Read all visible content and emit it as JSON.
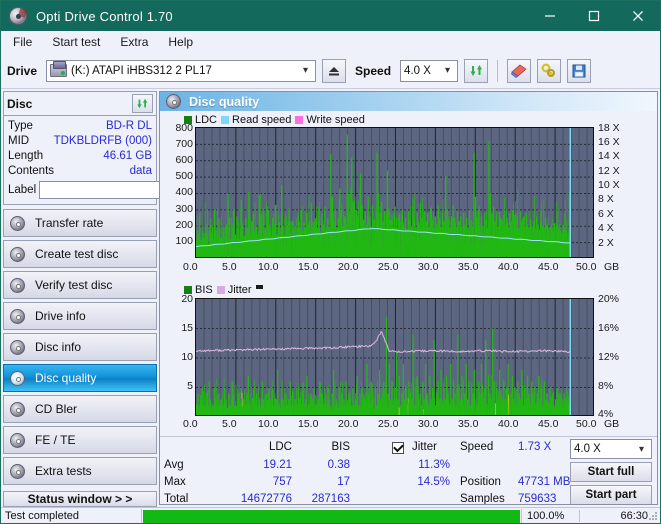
{
  "window": {
    "title": "Opti Drive Control 1.70",
    "icon": "disc-icon",
    "minimize": "minimize",
    "maximize": "maximize",
    "close": "close"
  },
  "menubar": {
    "items": [
      "File",
      "Start test",
      "Extra",
      "Help"
    ]
  },
  "toolbar": {
    "drive_label": "Drive",
    "drive_value": "(K:)  ATAPI iHBS312  2 PL17",
    "eject_title": "eject",
    "speed_label": "Speed",
    "speed_value": "4.0 X",
    "refresh_title": "refresh",
    "erase_title": "erase",
    "tools_title": "tools",
    "save_title": "save"
  },
  "disc": {
    "header": "Disc",
    "refresh_icon": "refresh-icon",
    "rows": [
      {
        "key": "Type",
        "value": "BD-R DL"
      },
      {
        "key": "MID",
        "value": "TDKBLDRFB (000)"
      },
      {
        "key": "Length",
        "value": "46.61 GB"
      },
      {
        "key": "Contents",
        "value": "data"
      }
    ],
    "label_key": "Label",
    "label_value": "",
    "label_placeholder": ""
  },
  "nav": {
    "items": [
      {
        "label": "Transfer rate",
        "active": false
      },
      {
        "label": "Create test disc",
        "active": false
      },
      {
        "label": "Verify test disc",
        "active": false
      },
      {
        "label": "Drive info",
        "active": false
      },
      {
        "label": "Disc info",
        "active": false
      },
      {
        "label": "Disc quality",
        "active": true
      },
      {
        "label": "CD Bler",
        "active": false
      },
      {
        "label": "FE / TE",
        "active": false
      },
      {
        "label": "Extra tests",
        "active": false
      }
    ],
    "status_window": "Status window > >"
  },
  "panel": {
    "title": "Disc quality",
    "icon": "disc-quality-icon"
  },
  "stats": {
    "col_ldc": "LDC",
    "col_bis": "BIS",
    "jitter_label": "Jitter",
    "jitter_checked": true,
    "rows": [
      {
        "key": "Avg",
        "ldc": "19.21",
        "bis": "0.38",
        "jitter": "11.3%"
      },
      {
        "key": "Max",
        "ldc": "757",
        "bis": "17",
        "jitter": "14.5%"
      },
      {
        "key": "Total",
        "ldc": "14672776",
        "bis": "287163",
        "jitter": ""
      }
    ],
    "speed_key": "Speed",
    "speed_value": "1.73 X",
    "position_key": "Position",
    "position_value": "47731 MB",
    "samples_key": "Samples",
    "samples_value": "759633",
    "speed_select": "4.0 X",
    "start_full": "Start full",
    "start_part": "Start part"
  },
  "statusbar": {
    "text": "Test completed",
    "percent": "100.0%",
    "progress": 100,
    "time": "66:30"
  },
  "colors": {
    "titlebar": "#12695c",
    "accent": "#2a2ad0",
    "plot_bg": "#5c6680",
    "ldc_green": "#22b814",
    "read_speed": "#7fd8f5",
    "write_speed": "#ff6ee0",
    "jitter_pink": "#d8aadd",
    "bis_green": "#22b814",
    "progress_green": "#14b814",
    "nav_active": "#0f8fd8"
  },
  "chart_data": [
    {
      "type": "bar",
      "name": "top-chart-ldc",
      "title": "",
      "xlabel": "GB",
      "ylabel": "LDC",
      "legend": [
        "LDC",
        "Read speed",
        "Write speed"
      ],
      "legend_colors": [
        "#148014",
        "#7fd8f5",
        "#ff6ee0"
      ],
      "legend_position": "top-left",
      "grid": true,
      "xlim": [
        0,
        50
      ],
      "ylim": [
        0,
        800
      ],
      "xticks": [
        "0.0",
        "5.0",
        "10.0",
        "15.0",
        "20.0",
        "25.0",
        "30.0",
        "35.0",
        "40.0",
        "45.0",
        "50.0"
      ],
      "yticks": [
        100,
        200,
        300,
        400,
        500,
        600,
        700,
        800
      ],
      "y2label": "X",
      "y2lim": [
        0,
        18
      ],
      "y2ticks": [
        "2 X",
        "4 X",
        "6 X",
        "8 X",
        "10 X",
        "12 X",
        "14 X",
        "16 X",
        "18 X"
      ],
      "data_end_x": 46.9,
      "series": [
        {
          "name": "LDC",
          "color": "#22b814",
          "type": "bar",
          "values": [
            95,
            150,
            280,
            110,
            90,
            130,
            200,
            160,
            95,
            210,
            150,
            120,
            300,
            180,
            130,
            250,
            120,
            100,
            170,
            140,
            210,
            400,
            250,
            120,
            190,
            300,
            150,
            260,
            180,
            120,
            360,
            200,
            140,
            250,
            190,
            410,
            150,
            230,
            280,
            160,
            200,
            150,
            390,
            230,
            130,
            260,
            190,
            160,
            300,
            210,
            140,
            250,
            190,
            330,
            150,
            220,
            180,
            450,
            200,
            140,
            260,
            190,
            310,
            160,
            230,
            180,
            200,
            150,
            260,
            190,
            300,
            170,
            220,
            190,
            280,
            210,
            150,
            340,
            200,
            170,
            250,
            190,
            230,
            160,
            280,
            210,
            320,
            180,
            250,
            200,
            640,
            380,
            230,
            300,
            190,
            250,
            430,
            300,
            200,
            260,
            210,
            760,
            400,
            280,
            620,
            350,
            230,
            300,
            260,
            190,
            520,
            330,
            240,
            290,
            210,
            380,
            260,
            200,
            330,
            240,
            190,
            650,
            400,
            280,
            350,
            230,
            290,
            200,
            540,
            310,
            240,
            270,
            200,
            320,
            250,
            190,
            280,
            230,
            300,
            210,
            250,
            180,
            290,
            240,
            200,
            320,
            260,
            190,
            280,
            220,
            340,
            250,
            200,
            290,
            230,
            270,
            200,
            310,
            240,
            190,
            260,
            210,
            330,
            250,
            200,
            280,
            230,
            510,
            300,
            240,
            190,
            260,
            330,
            250,
            200,
            290,
            230,
            260,
            200,
            280,
            210,
            250,
            190,
            300,
            240,
            200,
            650,
            380,
            250,
            300,
            210,
            260,
            200,
            280,
            240,
            190,
            720,
            400,
            280,
            320,
            230,
            260,
            200,
            290,
            240,
            190,
            270,
            210,
            250,
            190,
            280,
            230,
            300,
            240,
            200,
            260,
            190,
            290,
            230,
            250,
            200,
            280,
            210,
            190,
            240,
            200,
            230,
            190,
            260,
            210,
            180,
            230,
            200,
            190,
            250,
            210,
            180,
            200,
            190,
            170,
            220,
            200,
            180,
            190,
            170,
            160,
            200,
            180,
            170,
            160,
            150
          ]
        },
        {
          "name": "Read speed",
          "color": "#7fd8f5",
          "type": "line",
          "note": "rises from ~1.7X at 0GB to ~4.2X around 22GB then declines to ~2.2X at 47GB"
        },
        {
          "name": "Write speed",
          "color": "#ff6ee0",
          "type": "line",
          "note": "not present in this plot"
        }
      ]
    },
    {
      "type": "bar",
      "name": "bottom-chart-bis-jitter",
      "title": "",
      "xlabel": "GB",
      "ylabel": "BIS",
      "legend": [
        "BIS",
        "Jitter"
      ],
      "legend_colors": [
        "#148014",
        "#d8aadd"
      ],
      "legend_position": "top-left",
      "grid": true,
      "xlim": [
        0,
        50
      ],
      "ylim": [
        0,
        20
      ],
      "xticks": [
        "0.0",
        "5.0",
        "10.0",
        "15.0",
        "20.0",
        "25.0",
        "30.0",
        "35.0",
        "40.0",
        "45.0",
        "50.0"
      ],
      "yticks": [
        5,
        10,
        15,
        20
      ],
      "y2label": "%",
      "y2lim": [
        0,
        20
      ],
      "y2ticks": [
        "4%",
        "8%",
        "12%",
        "16%",
        "20%"
      ],
      "data_end_x": 46.9,
      "series": [
        {
          "name": "BIS",
          "color": "#22b814",
          "type": "bar",
          "values": [
            2,
            4,
            1,
            3,
            5,
            2,
            1,
            4,
            2,
            6,
            3,
            1,
            2,
            5,
            3,
            2,
            4,
            1,
            3,
            2,
            5,
            3,
            1,
            4,
            2,
            3,
            6,
            2,
            1,
            4,
            3,
            2,
            5,
            1,
            3,
            2,
            4,
            7,
            2,
            1,
            3,
            5,
            2,
            4,
            1,
            3,
            2,
            6,
            3,
            1,
            4,
            2,
            5,
            3,
            1,
            2,
            4,
            3,
            8,
            2,
            1,
            5,
            3,
            2,
            4,
            1,
            3,
            6,
            2,
            4,
            1,
            3,
            2,
            5,
            3,
            1,
            4,
            2,
            3,
            7,
            2,
            1,
            4,
            3,
            5,
            2,
            1,
            3,
            6,
            2,
            4,
            1,
            3,
            2,
            5,
            3,
            1,
            4,
            8,
            2,
            3,
            1,
            5,
            2,
            4,
            3,
            1,
            6,
            2,
            4,
            3,
            1,
            5,
            2,
            3,
            7,
            1,
            4,
            2,
            5,
            3,
            1,
            9,
            4,
            2,
            6,
            3,
            1,
            5,
            2,
            4,
            8,
            3,
            1,
            6,
            2,
            17,
            4,
            9,
            3,
            6,
            2,
            5,
            11,
            3,
            7,
            2,
            4,
            9,
            3,
            5,
            2,
            6,
            4,
            3,
            14,
            2,
            5,
            7,
            3,
            4,
            2,
            6,
            3,
            9,
            4,
            2,
            7,
            3,
            5,
            13,
            2,
            4,
            6,
            3,
            8,
            2,
            5,
            3,
            7,
            4,
            2,
            9,
            3,
            6,
            4,
            2,
            14,
            5,
            3,
            7,
            2,
            4,
            9,
            3,
            6,
            2,
            5,
            4,
            8,
            3,
            2,
            6,
            4,
            9,
            3,
            5,
            13,
            2,
            7,
            4,
            3,
            15,
            6,
            2,
            5,
            3,
            8,
            4,
            2,
            6,
            3,
            5,
            9,
            2,
            4,
            7,
            3,
            5,
            2,
            6,
            4,
            3,
            8,
            2,
            5,
            3,
            7,
            4,
            2,
            6,
            3,
            5,
            2,
            4,
            7,
            3,
            5,
            2,
            6,
            3,
            4,
            2,
            5,
            3,
            4,
            2,
            3,
            5,
            2,
            4,
            3,
            2,
            4,
            3,
            2,
            3,
            2
          ]
        },
        {
          "name": "Jitter",
          "color": "#d8aadd",
          "type": "line",
          "note": "flat near 11.2-11.5 (≈11.3%) rising slightly to 12 around 18-21GB, peak ~14.5 at 23GB, then flat ~11.1"
        }
      ]
    }
  ]
}
